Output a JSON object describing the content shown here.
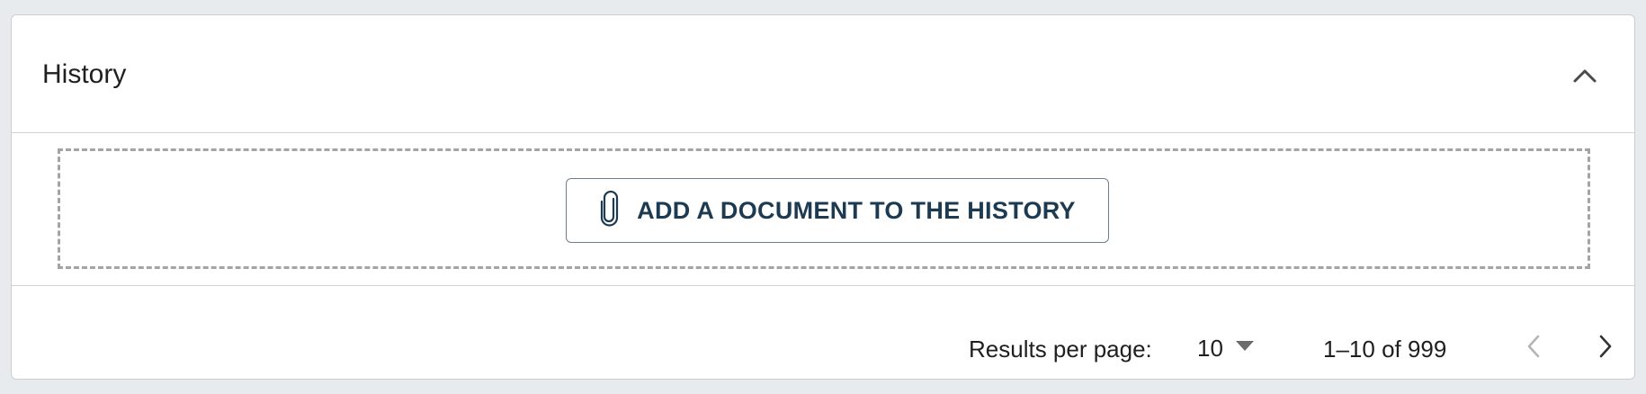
{
  "panel": {
    "title": "History",
    "collapse_icon": "chevron-up-icon"
  },
  "dropzone": {
    "button_label": "ADD A DOCUMENT TO THE HISTORY",
    "button_icon": "paperclip-icon"
  },
  "pagination": {
    "rows_per_page_label": "Results per page:",
    "rows_per_page_value": "10",
    "range_label": "1–10 of 999",
    "prev_icon": "chevron-left-icon",
    "next_icon": "chevron-right-icon",
    "prev_disabled": true
  },
  "colors": {
    "page_background": "#e8ebee",
    "button_text": "#1c3a52",
    "button_border": "#6d7f8d",
    "dashed_border": "#a4a4a4",
    "disabled_icon": "#b5b5b5"
  }
}
